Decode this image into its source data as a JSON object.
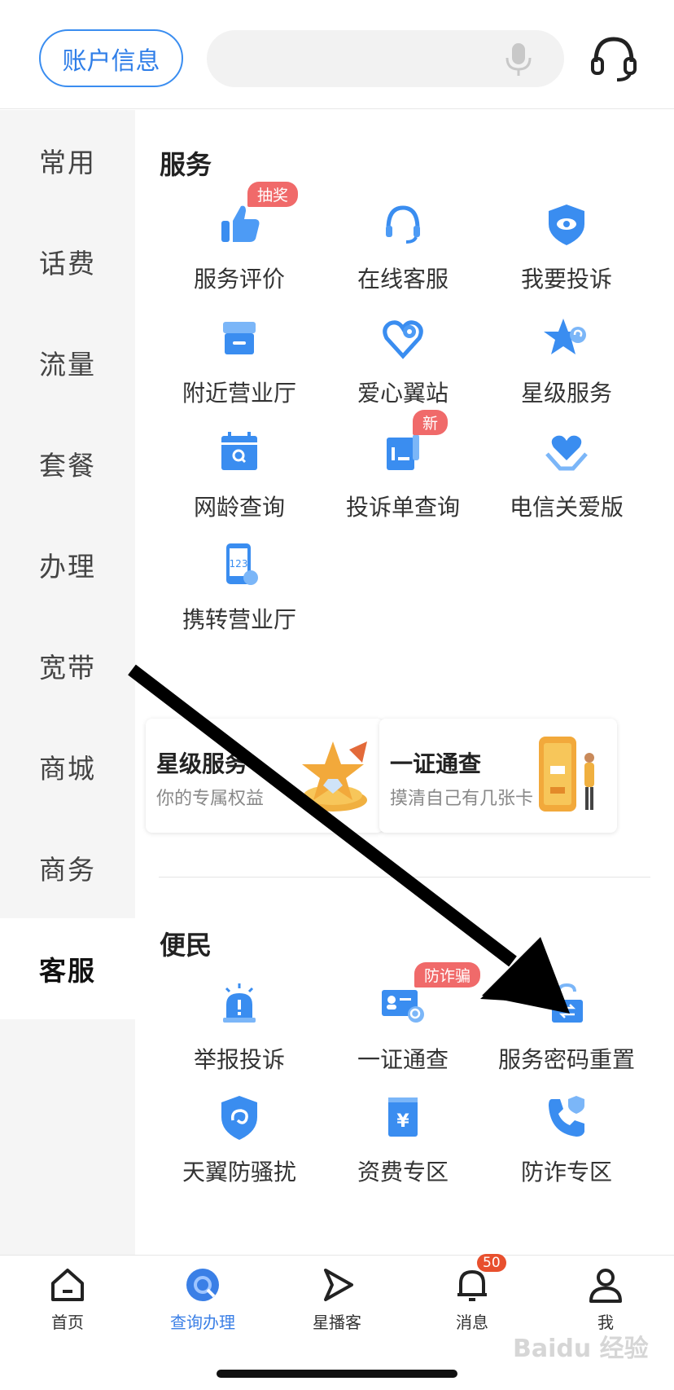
{
  "header": {
    "account_button": "账户信息",
    "search_placeholder": ""
  },
  "sidebar": {
    "items": [
      {
        "label": "常用"
      },
      {
        "label": "话费"
      },
      {
        "label": "流量"
      },
      {
        "label": "套餐"
      },
      {
        "label": "办理"
      },
      {
        "label": "宽带"
      },
      {
        "label": "商城"
      },
      {
        "label": "商务"
      },
      {
        "label": "客服",
        "active": true
      }
    ]
  },
  "service": {
    "title": "服务",
    "items": [
      {
        "label": "服务评价",
        "icon": "thumbs-up-icon",
        "tag": "抽奖"
      },
      {
        "label": "在线客服",
        "icon": "headset-icon"
      },
      {
        "label": "我要投诉",
        "icon": "shield-eye-icon"
      },
      {
        "label": "附近营业厅",
        "icon": "store-icon"
      },
      {
        "label": "爱心翼站",
        "icon": "heart-location-icon"
      },
      {
        "label": "星级服务",
        "icon": "star-icon"
      },
      {
        "label": "网龄查询",
        "icon": "calendar-search-icon"
      },
      {
        "label": "投诉单查询",
        "icon": "document-icon",
        "tag": "新"
      },
      {
        "label": "电信关爱版",
        "icon": "heart-hands-icon"
      },
      {
        "label": "携转营业厅",
        "icon": "phone-123-icon"
      }
    ]
  },
  "promos": [
    {
      "title": "星级服务",
      "subtitle": "你的专属权益"
    },
    {
      "title": "一证通查",
      "subtitle": "摸清自己有几张卡"
    }
  ],
  "convenience": {
    "title": "便民",
    "items": [
      {
        "label": "举报投诉",
        "icon": "alarm-icon"
      },
      {
        "label": "一证通查",
        "icon": "id-card-search-icon",
        "tag": "防诈骗"
      },
      {
        "label": "服务密码重置",
        "icon": "unlock-icon"
      },
      {
        "label": "天翼防骚扰",
        "icon": "shield-swirl-icon"
      },
      {
        "label": "资费专区",
        "icon": "yuan-icon"
      },
      {
        "label": "防诈专区",
        "icon": "phone-shield-icon"
      }
    ]
  },
  "bottom_nav": {
    "items": [
      {
        "label": "首页",
        "icon": "home-icon"
      },
      {
        "label": "查询办理",
        "icon": "search-icon",
        "active": true
      },
      {
        "label": "星播客",
        "icon": "play-icon"
      },
      {
        "label": "消息",
        "icon": "bell-icon",
        "badge": "50"
      },
      {
        "label": "我",
        "icon": "user-icon"
      }
    ]
  },
  "watermark": "Baidu 经验",
  "colors": {
    "accent": "#3a8df0",
    "tag": "#f06a6a",
    "badge": "#e8502e"
  }
}
